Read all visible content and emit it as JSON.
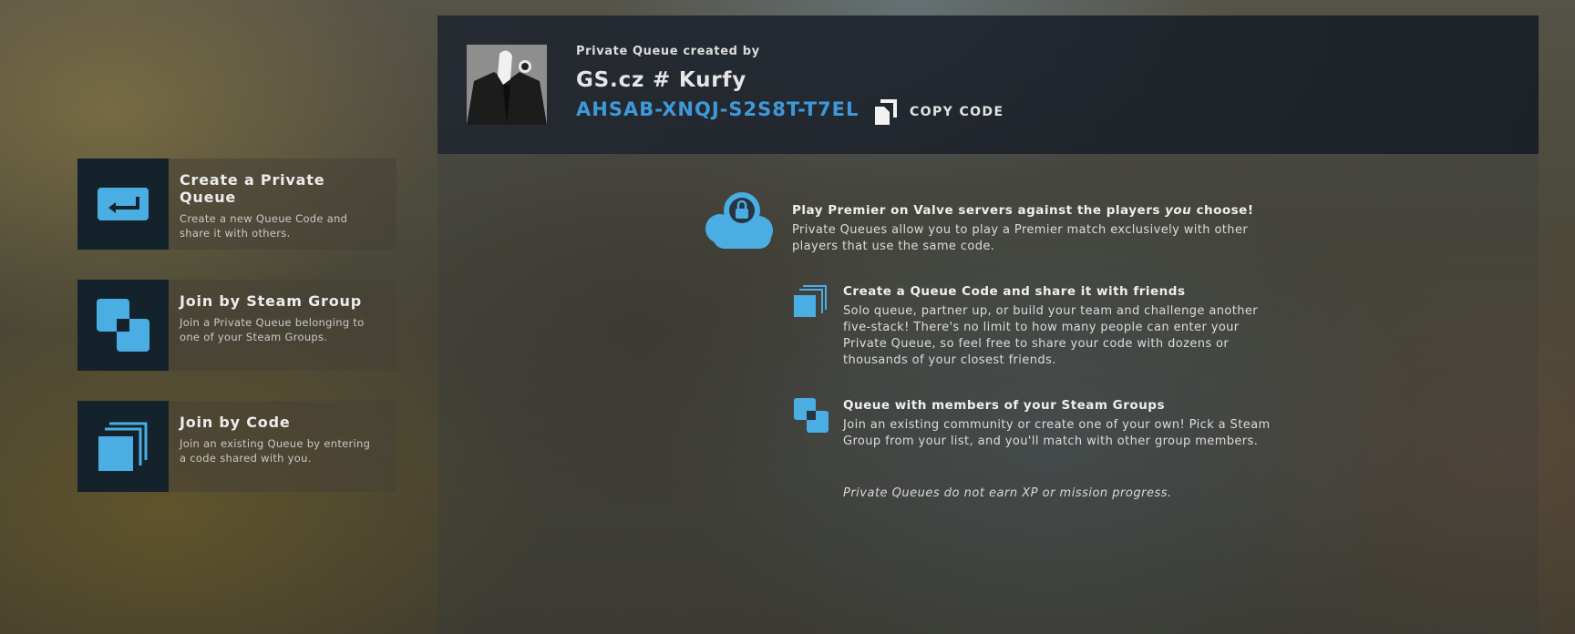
{
  "menu": [
    {
      "title": "Create a Private Queue",
      "description": "Create a new Queue Code and share it with others.",
      "icon": "return-arrow-icon"
    },
    {
      "title": "Join by Steam Group",
      "description": "Join a Private Queue belonging to one of your Steam Groups.",
      "icon": "steam-group-icon"
    },
    {
      "title": "Join by Code",
      "description": "Join an existing Queue by entering a code shared with you.",
      "icon": "stacked-cards-icon"
    }
  ],
  "header": {
    "created_by_label": "Private Queue created by",
    "owner_name": "GS.cz # Kurfy",
    "queue_code": "AHSAB-XNQJ-S2S8T-T7EL",
    "copy_label": "COPY CODE"
  },
  "info": {
    "headline_before": "Play Premier on Valve servers against the players ",
    "headline_emphasis": "you",
    "headline_after": " choose!",
    "intro": "Private Queues allow you to play a Premier match exclusively with other players that use the same code.",
    "sections": [
      {
        "title": "Create a Queue Code and share it with friends",
        "text": "Solo queue, partner up, or build your team and challenge another five-stack! There's no limit to how many people can enter your Private Queue, so feel free to share your code with dozens or thousands of your closest friends."
      },
      {
        "title": "Queue with members of your Steam Groups",
        "text": "Join an existing community or create one of your own! Pick a Steam Group from your list, and you'll match with other group members."
      }
    ],
    "note": "Private Queues do not earn XP or mission progress."
  },
  "colors": {
    "accent_blue": "#3d9ad9",
    "icon_blue": "#4aaee3",
    "icon_box": "#14222c"
  }
}
